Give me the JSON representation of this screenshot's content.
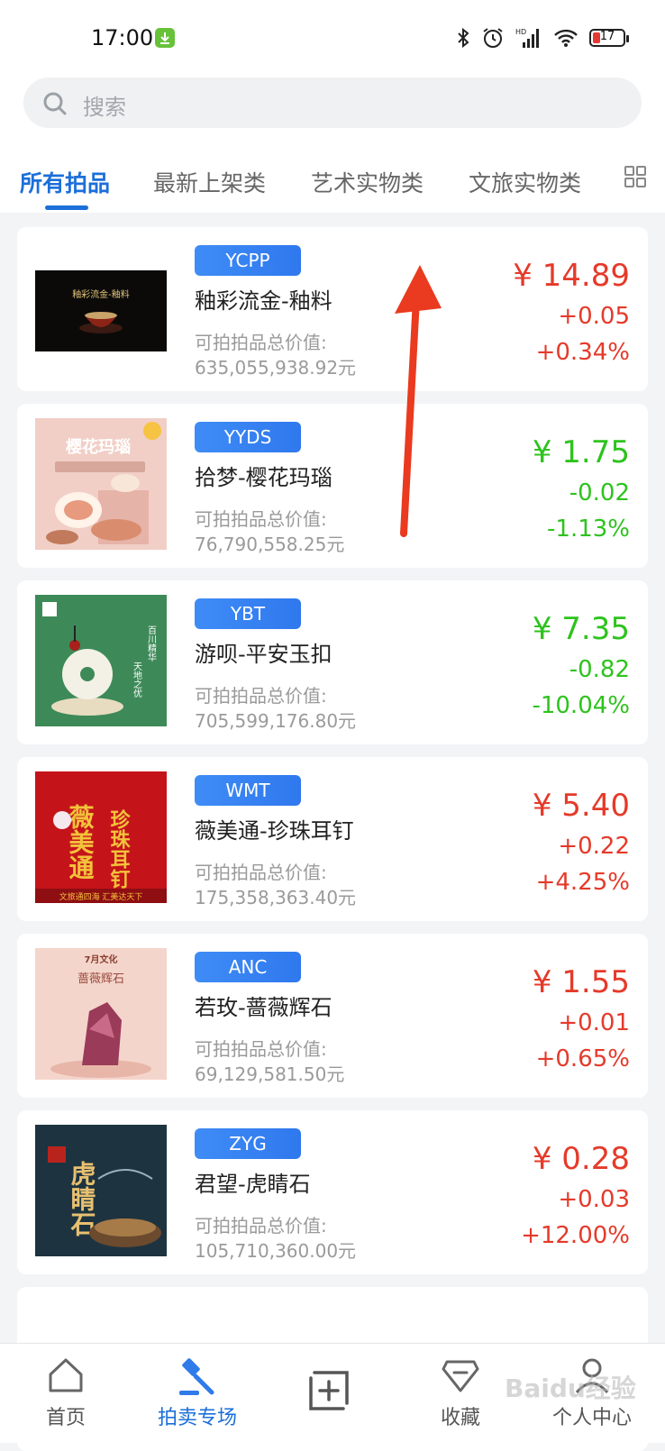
{
  "status_bar": {
    "time": "17:00",
    "battery": "17"
  },
  "search": {
    "placeholder": "搜索"
  },
  "tabs": [
    {
      "label": "所有拍品",
      "active": true
    },
    {
      "label": "最新上架类",
      "active": false
    },
    {
      "label": "艺术实物类",
      "active": false
    },
    {
      "label": "文旅实物类",
      "active": false
    }
  ],
  "colors": {
    "accent": "#1c6fd9",
    "up": "#e53a2a",
    "down": "#2ec31e"
  },
  "items": [
    {
      "code": "YCPP",
      "name": "釉彩流金-釉料",
      "cap_label": "可拍拍品总价值:",
      "cap_value": "635,055,938.92元",
      "price": "¥ 14.89",
      "change": "+0.05",
      "percent": "+0.34%",
      "trend": "up"
    },
    {
      "code": "YYDS",
      "name": "拾梦-樱花玛瑙",
      "cap_label": "可拍拍品总价值:",
      "cap_value": "76,790,558.25元",
      "price": "¥ 1.75",
      "change": "-0.02",
      "percent": "-1.13%",
      "trend": "down"
    },
    {
      "code": "YBT",
      "name": "游呗-平安玉扣",
      "cap_label": "可拍拍品总价值:",
      "cap_value": "705,599,176.80元",
      "price": "¥ 7.35",
      "change": "-0.82",
      "percent": "-10.04%",
      "trend": "down"
    },
    {
      "code": "WMT",
      "name": "薇美通-珍珠耳钉",
      "cap_label": "可拍拍品总价值:",
      "cap_value": "175,358,363.40元",
      "price": "¥ 5.40",
      "change": "+0.22",
      "percent": "+4.25%",
      "trend": "up"
    },
    {
      "code": "ANC",
      "name": "若玫-蔷薇辉石",
      "cap_label": "可拍拍品总价值:",
      "cap_value": "69,129,581.50元",
      "price": "¥ 1.55",
      "change": "+0.01",
      "percent": "+0.65%",
      "trend": "up"
    },
    {
      "code": "ZYG",
      "name": "君望-虎睛石",
      "cap_label": "可拍拍品总价值:",
      "cap_value": "105,710,360.00元",
      "price": "¥ 0.28",
      "change": "+0.03",
      "percent": "+12.00%",
      "trend": "up"
    }
  ],
  "thumb_text": {
    "t1": "釉彩流金-釉料",
    "t2": "樱花玛瑙",
    "t3a": "百川精华",
    "t3b": "天地之优",
    "t4a": "薇美通",
    "t4b": "珍珠耳钉",
    "t4c": "文旅通四海 汇美达天下",
    "t5a": "7月文化",
    "t5b": "蔷薇辉石",
    "t6": "虎睛石"
  },
  "bottom_nav": [
    {
      "label": "首页",
      "icon": "home-icon",
      "active": false
    },
    {
      "label": "拍卖专场",
      "icon": "auction-hammer-icon",
      "active": true
    },
    {
      "label": "",
      "icon": "add-swap-icon",
      "active": false
    },
    {
      "label": "收藏",
      "icon": "favorite-icon",
      "active": false
    },
    {
      "label": "个人中心",
      "icon": "user-icon",
      "active": false
    }
  ],
  "watermark": "Baidu经验"
}
